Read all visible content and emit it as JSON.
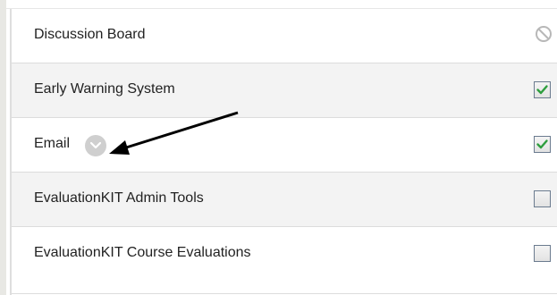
{
  "tools": [
    {
      "name": "Discussion Board",
      "status": "disabled",
      "status_icon": "disabled-icon",
      "menu": false
    },
    {
      "name": "Early Warning System",
      "status": "checked",
      "status_icon": "checkbox-checked-icon",
      "menu": false
    },
    {
      "name": "Email",
      "status": "checked",
      "status_icon": "checkbox-checked-icon",
      "menu": true,
      "menu_icon": "chevron-down-icon"
    },
    {
      "name": "EvaluationKIT Admin Tools",
      "status": "unchecked",
      "status_icon": "checkbox-unchecked-icon",
      "menu": false
    },
    {
      "name": "EvaluationKIT Course Evaluations",
      "status": "unchecked",
      "status_icon": "checkbox-unchecked-icon",
      "menu": false
    }
  ],
  "annotation": {
    "type": "arrow",
    "color": "#000000",
    "points_to": "Email options menu"
  },
  "colors": {
    "check_mark": "#2e9e3e",
    "checkbox_border": "#6b7b8f",
    "menu_button": "#cfcfcf",
    "row_alt": "#f3f3f3",
    "disabled_icon": "#b8b8b8"
  }
}
